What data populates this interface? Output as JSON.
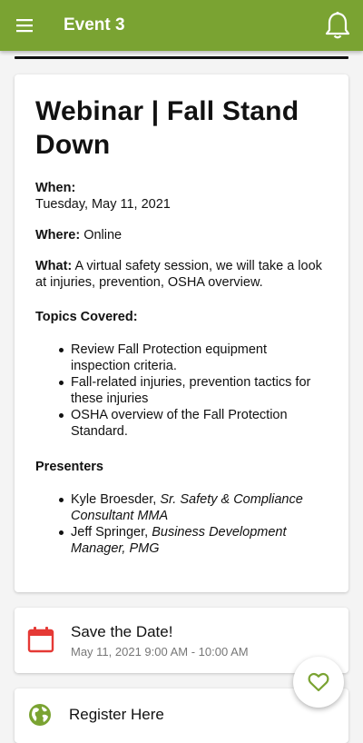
{
  "appbar": {
    "title": "Event 3"
  },
  "event": {
    "title": "Webinar | Fall Stand Down",
    "when_label": "When:",
    "when_value": "Tuesday, May 11, 2021",
    "where_label": "Where:",
    "where_value": "Online",
    "what_label": "What:",
    "what_value": "A virtual safety session, we will take a look at injuries, prevention, OSHA overview.",
    "topics_label": "Topics Covered:",
    "topics": [
      "Review Fall Protection equipment inspection criteria.",
      "Fall-related injuries, prevention tactics for these injuries",
      "OSHA overview of the Fall Protection Standard."
    ],
    "presenters_label": "Presenters",
    "presenters": [
      {
        "name": "Kyle Broesder,",
        "role": "Sr. Safety & Compliance Consultant MMA"
      },
      {
        "name": "Jeff Springer,",
        "role": "Business Development Manager, PMG"
      }
    ]
  },
  "save_date": {
    "title": "Save the Date!",
    "time": "May 11, 2021 9:00 AM - 10:00 AM"
  },
  "register": {
    "title": "Register Here"
  },
  "colors": {
    "primary": "#7aa332",
    "calendar": "#e53935",
    "globe": "#7aa332"
  },
  "icons": [
    "menu-icon",
    "bell-icon",
    "calendar-icon",
    "globe-icon",
    "heart-icon"
  ]
}
